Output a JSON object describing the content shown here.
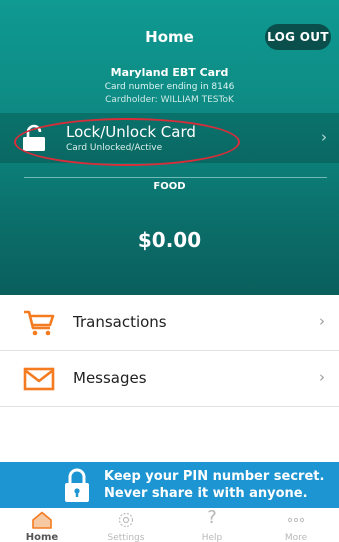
{
  "header": {
    "title": "Home",
    "logout_label": "LOG OUT",
    "card_name": "Maryland EBT Card",
    "card_number": "Card number ending in 8146",
    "cardholder": "Cardholder: WILLIAM TESToK"
  },
  "lock": {
    "title": "Lock/Unlock Card",
    "status": "Card Unlocked/Active"
  },
  "balance": {
    "label": "FOOD",
    "amount": "$0.00"
  },
  "list": [
    {
      "label": "Transactions",
      "icon": "shopping-cart-icon"
    },
    {
      "label": "Messages",
      "icon": "envelope-icon"
    }
  ],
  "banner": {
    "line1": "Keep your PIN number secret.",
    "line2": "Never share it with anyone."
  },
  "tabs": [
    {
      "label": "Home",
      "icon": "home-icon"
    },
    {
      "label": "Settings",
      "icon": "gear-icon"
    },
    {
      "label": "Help",
      "icon": "question-icon"
    },
    {
      "label": "More",
      "icon": "more-dots-icon"
    }
  ],
  "colors": {
    "teal": "#0d8780",
    "orange": "#f47b20",
    "banner_blue": "#1d95d2",
    "highlight_red": "#d92d3a"
  }
}
